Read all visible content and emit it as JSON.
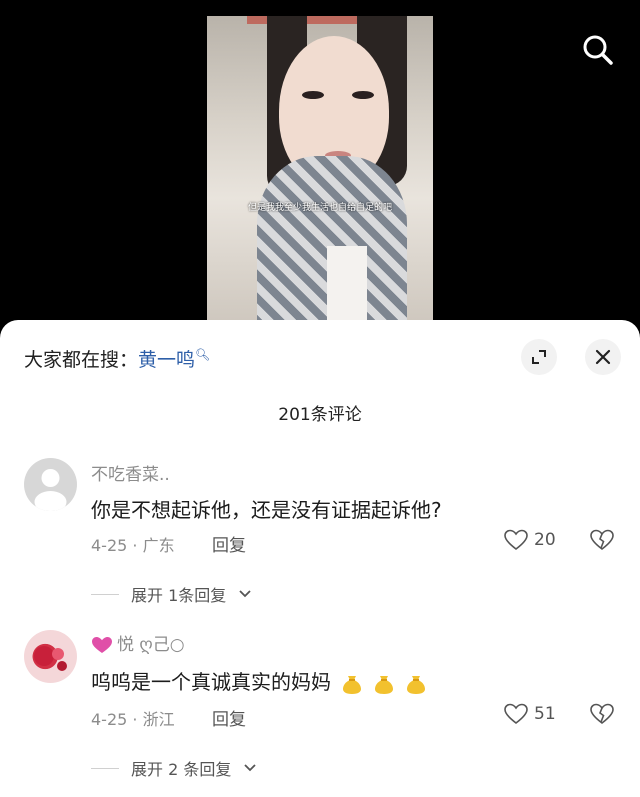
{
  "video": {
    "caption": "但是我我至少我生活也自给自足的吧"
  },
  "panel": {
    "search_prefix": "大家都在搜：",
    "search_keyword": "黄一鸣",
    "comment_count": "201条评论"
  },
  "comments": [
    {
      "username": "不吃香菜..",
      "text": "你是不想起诉他，还是没有证据起诉他?",
      "date": "4-25",
      "location": "广东",
      "reply_label": "回复",
      "likes": "20",
      "expand_label": "展开 1条回复"
    },
    {
      "username": "悦 ღ己○",
      "text": "呜呜是一个真诚真实的妈妈",
      "date": "4-25",
      "location": "浙江",
      "reply_label": "回复",
      "likes": "51",
      "expand_label": "展开 2 条回复"
    }
  ],
  "colors": {
    "link_blue": "#2e5fa8",
    "gray_text": "#8c8c8c",
    "emoji_gold": "#f2c12e"
  },
  "icons": [
    "search-icon",
    "expand-icon",
    "close-icon",
    "heart-icon",
    "broken-heart-icon",
    "chevron-down-icon",
    "heart-emoji-icon",
    "money-bag-emoji-icon"
  ]
}
